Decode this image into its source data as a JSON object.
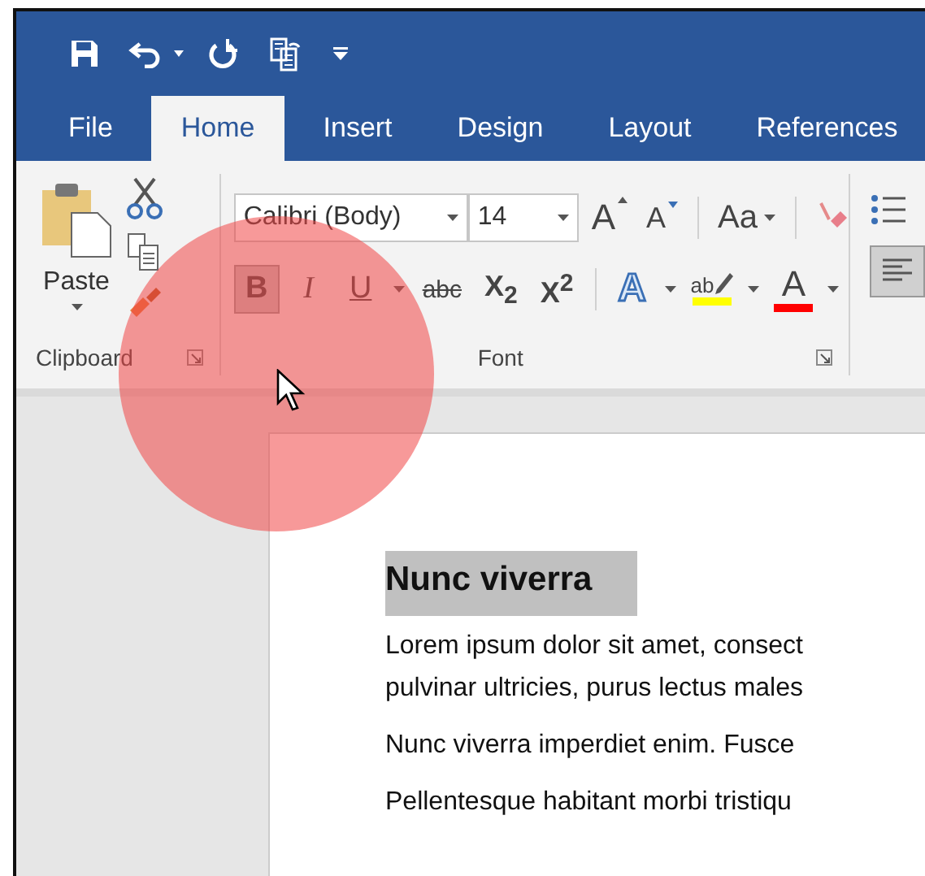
{
  "tabs": [
    {
      "label": "File",
      "selected": false
    },
    {
      "label": "Home",
      "selected": true
    },
    {
      "label": "Insert",
      "selected": false
    },
    {
      "label": "Design",
      "selected": false
    },
    {
      "label": "Layout",
      "selected": false
    },
    {
      "label": "References",
      "selected": false
    }
  ],
  "clipboard": {
    "paste_label": "Paste",
    "group_label": "Clipboard"
  },
  "font": {
    "font_name": "Calibri (Body)",
    "font_size": "14",
    "group_label": "Font",
    "size_buttons": [
      {
        "kind": "grow",
        "label": "A"
      },
      {
        "kind": "shrink",
        "label": "A"
      }
    ],
    "change_case": "Aa",
    "format_buttons": [
      {
        "kind": "bold",
        "label": "B",
        "selected": true,
        "dropdown": false
      },
      {
        "kind": "italic",
        "label": "I",
        "selected": false,
        "dropdown": false
      },
      {
        "kind": "underline",
        "label": "U",
        "selected": false,
        "dropdown": true
      },
      {
        "kind": "strikethrough",
        "label": "abc",
        "selected": false,
        "dropdown": false
      },
      {
        "kind": "script",
        "label": "X$_{2}$",
        "selected": false,
        "dropdown": false
      },
      {
        "kind": "script",
        "label": "X$^{2}$",
        "selected": false,
        "dropdown": false
      }
    ],
    "color_buttons": [
      {
        "kind": "text_effects",
        "label": "A",
        "dropdown": true
      },
      {
        "kind": "highlight",
        "label": "ab",
        "color": "#ffff00",
        "dropdown": true
      },
      {
        "kind": "font_color",
        "label": "A",
        "color": "#ff0000",
        "dropdown": true
      }
    ]
  },
  "paragraph": {
    "align_left_selected": true
  },
  "document": {
    "heading": {
      "text": "Nunc viverra",
      "selected": true
    },
    "paragraphs": [
      {
        "lines": [
          "Lorem ipsum dolor sit amet, consect",
          "pulvinar ultricies, purus lectus males"
        ]
      },
      {
        "lines": [
          "Nunc viverra imperdiet enim. Fusce"
        ]
      },
      {
        "lines": [
          "Pellentesque habitant morbi tristiqu"
        ]
      }
    ]
  }
}
